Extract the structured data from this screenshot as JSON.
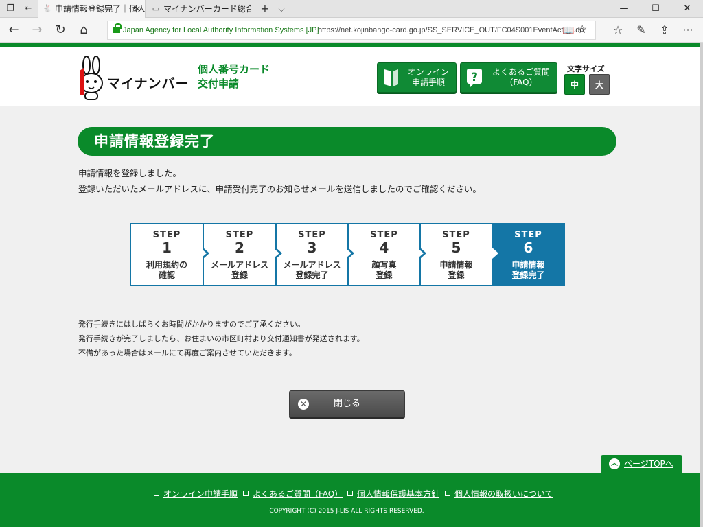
{
  "browser": {
    "tabs": [
      {
        "title": "申請情報登録完了｜個人",
        "active": true
      },
      {
        "title": "マイナンバーカード総合サイト／",
        "active": false
      }
    ],
    "certificate": "Japan Agency for Local Authority Information Systems [JP]",
    "url": "https://net.kojinbango-card.go.jp/SS_SERVICE_OUT/FC04S001EventAction.do"
  },
  "header": {
    "logo_text": "マイナンバー",
    "service_title_line1": "個人番号カード",
    "service_title_line2": "交付申請",
    "online_btn": {
      "line1": "オンライン",
      "line2": "申請手順"
    },
    "faq_btn": {
      "line1": "よくあるご質問",
      "line2": "（FAQ）"
    },
    "font_size_label": "文字サイズ",
    "font_mid": "中",
    "font_big": "大"
  },
  "main": {
    "title": "申請情報登録完了",
    "message1": "申請情報を登録しました。",
    "message2": "登録いただいたメールアドレスに、申請受付完了のお知らせメールを送信しましたのでご確認ください。",
    "steps": [
      {
        "word": "STEP",
        "num": "1",
        "line1": "利用規約の",
        "line2": "確認"
      },
      {
        "word": "STEP",
        "num": "2",
        "line1": "メールアドレス",
        "line2": "登録"
      },
      {
        "word": "STEP",
        "num": "3",
        "line1": "メールアドレス",
        "line2": "登録完了"
      },
      {
        "word": "STEP",
        "num": "4",
        "line1": "顔写真",
        "line2": "登録"
      },
      {
        "word": "STEP",
        "num": "5",
        "line1": "申請情報",
        "line2": "登録"
      },
      {
        "word": "STEP",
        "num": "6",
        "line1": "申請情報",
        "line2": "登録完了"
      }
    ],
    "notes": [
      "発行手続きにはしばらくお時間がかかりますのでご了承ください。",
      "発行手続きが完了しましたら、お住まいの市区町村より交付通知書が発送されます。",
      "不備があった場合はメールにて再度ご案内させていただきます。"
    ],
    "close_label": "閉じる",
    "pagetop_label": "ページTOPへ"
  },
  "footer": {
    "links": [
      "オンライン申請手順",
      "よくあるご質問（FAQ）",
      "個人情報保護基本方針",
      "個人情報の取扱いについて"
    ],
    "copyright": "COPYRIGHT (C) 2015 J-LIS ALL RIGHTS RESERVED."
  },
  "colors": {
    "brand_green": "#0a8a2a",
    "step_blue": "#1476a6"
  }
}
